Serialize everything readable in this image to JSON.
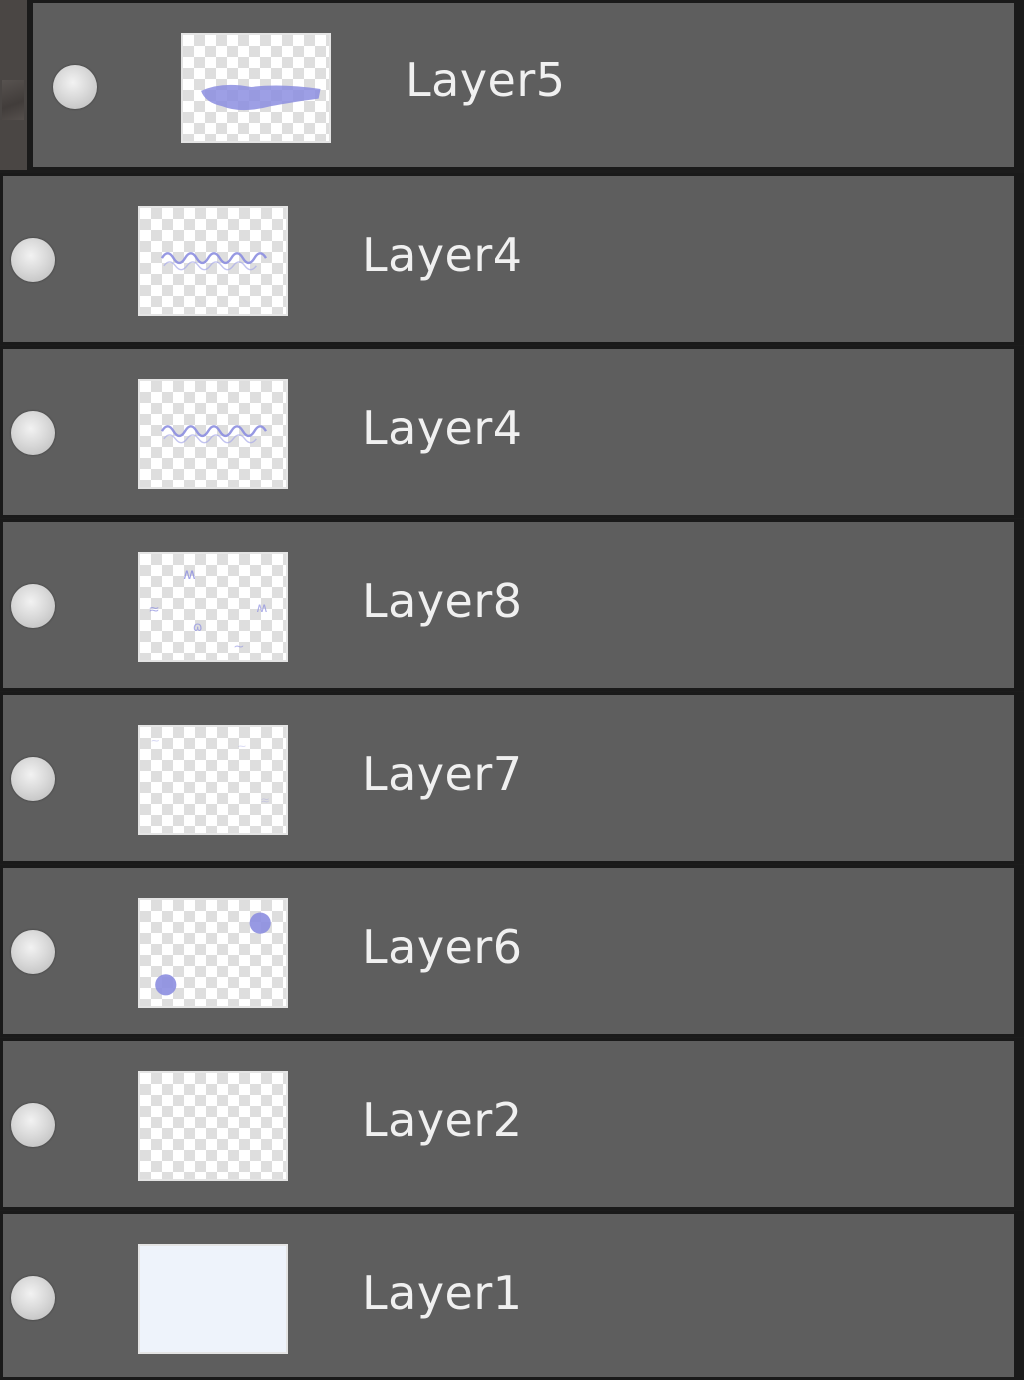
{
  "layers_panel": {
    "layers": [
      {
        "name": "Layer5",
        "visible": true,
        "thumbnail": "purple-brush-streak",
        "indented": true
      },
      {
        "name": "Layer4",
        "visible": true,
        "thumbnail": "purple-squiggle-line",
        "indented": false
      },
      {
        "name": "Layer4",
        "visible": true,
        "thumbnail": "purple-squiggle-line",
        "indented": false
      },
      {
        "name": "Layer8",
        "visible": true,
        "thumbnail": "scattered-purple-marks",
        "indented": false
      },
      {
        "name": "Layer7",
        "visible": true,
        "thumbnail": "faint-marks",
        "indented": false
      },
      {
        "name": "Layer6",
        "visible": true,
        "thumbnail": "two-purple-dots",
        "indented": false
      },
      {
        "name": "Layer2",
        "visible": true,
        "thumbnail": "empty-transparent",
        "indented": false
      },
      {
        "name": "Layer1",
        "visible": true,
        "thumbnail": "solid-light-blue",
        "indented": false
      }
    ],
    "colors": {
      "row_background": "#5e5e5e",
      "row_border": "#1a1a1a",
      "label_text": "#f0f0f0",
      "thumbnail_stroke": "#8c8ee0",
      "base_fill": "#eef3fb"
    }
  }
}
